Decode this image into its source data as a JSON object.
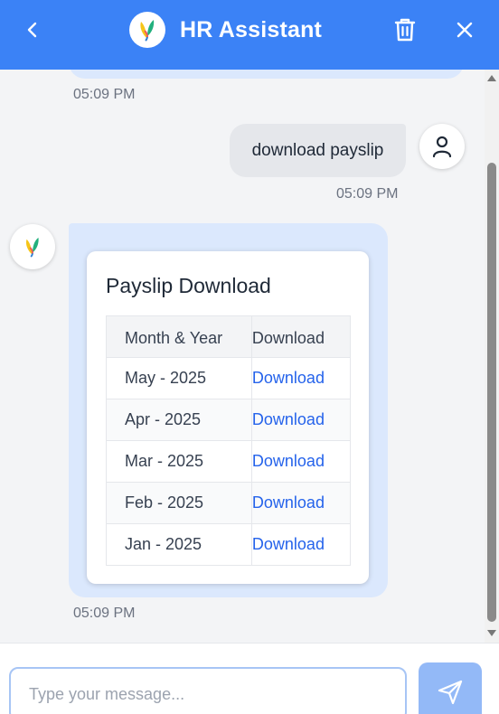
{
  "header": {
    "title": "HR Assistant",
    "icons": {
      "back": "chevron-left-icon",
      "delete": "trash-icon",
      "close": "close-icon",
      "logo": "leaf-logo"
    }
  },
  "colors": {
    "header_bg": "#3b82f6",
    "bot_bubble": "#dbe8fd",
    "user_bubble": "#e5e7eb",
    "link": "#2563eb",
    "send_button": "#93b9f7"
  },
  "messages": {
    "previous_bot": {
      "timestamp": "05:09 PM"
    },
    "user": {
      "text": "download payslip",
      "timestamp": "05:09 PM"
    },
    "bot": {
      "timestamp": "05:09 PM",
      "card": {
        "title": "Payslip Download",
        "columns": [
          "Month & Year",
          "Download"
        ],
        "rows": [
          {
            "month": "May - 2025",
            "link": "Download"
          },
          {
            "month": "Apr - 2025",
            "link": "Download"
          },
          {
            "month": "Mar - 2025",
            "link": "Download"
          },
          {
            "month": "Feb - 2025",
            "link": "Download"
          },
          {
            "month": "Jan - 2025",
            "link": "Download"
          }
        ]
      }
    }
  },
  "composer": {
    "placeholder": "Type your message...",
    "value": ""
  }
}
